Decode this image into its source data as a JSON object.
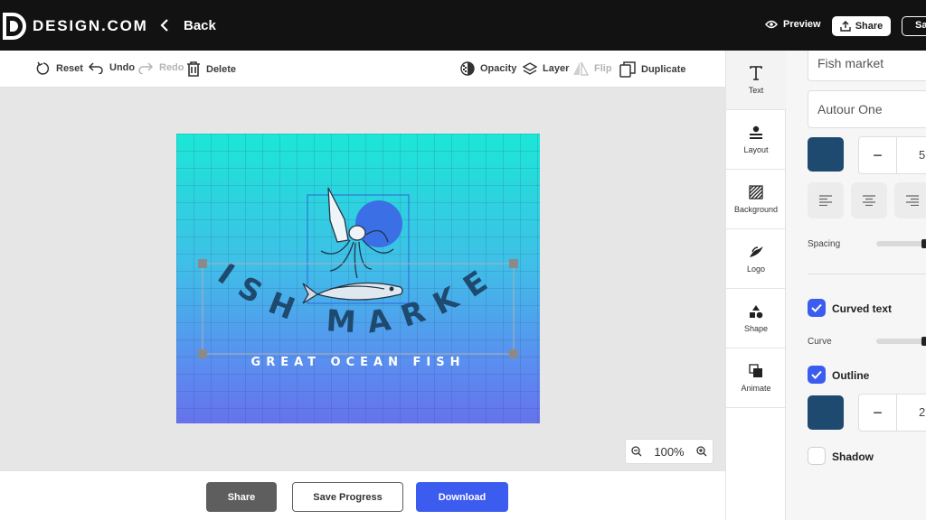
{
  "topbar": {
    "brand": "DESIGN.COM",
    "back_label": "Back",
    "preview_label": "Preview",
    "share_label": "Share",
    "save_label": "Sa"
  },
  "toolbar": {
    "reset": "Reset",
    "undo": "Undo",
    "redo": "Redo",
    "delete": "Delete",
    "opacity": "Opacity",
    "layer": "Layer",
    "flip": "Flip",
    "duplicate": "Duplicate"
  },
  "design": {
    "title": "FISH MARKET",
    "tagline": "GREAT OCEAN FISH",
    "text_color": "#1f4a6f",
    "circle_color": "#3a6fe6"
  },
  "zoom": {
    "level": "100%"
  },
  "bottombar": {
    "share": "Share",
    "save_progress": "Save Progress",
    "download": "Download"
  },
  "side_tabs": [
    {
      "label": "Text",
      "icon": "text-icon"
    },
    {
      "label": "Layout",
      "icon": "layout-icon"
    },
    {
      "label": "Background",
      "icon": "background-icon"
    },
    {
      "label": "Logo",
      "icon": "logo-bird-icon"
    },
    {
      "label": "Shape",
      "icon": "shape-icon"
    },
    {
      "label": "Animate",
      "icon": "animate-icon"
    }
  ],
  "panel": {
    "text_value": "Fish market",
    "font_name": "Autour One",
    "font_color": "#1f4a6f",
    "font_size": "5",
    "spacing_label": "Spacing",
    "curved_text_label": "Curved text",
    "curved_text_checked": true,
    "curve_label": "Curve",
    "outline_label": "Outline",
    "outline_checked": true,
    "outline_color": "#1f4a6f",
    "outline_size": "2",
    "shadow_label": "Shadow",
    "shadow_checked": false
  }
}
